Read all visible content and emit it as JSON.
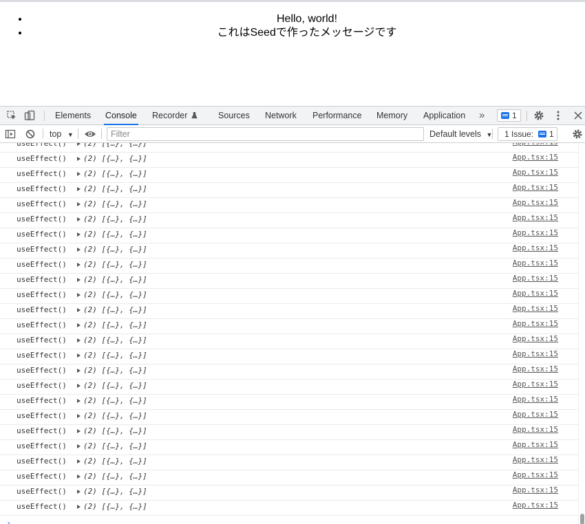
{
  "page": {
    "items": [
      "Hello, world!",
      "これはSeedで作ったメッセージです"
    ]
  },
  "devtools": {
    "tabs": [
      "Elements",
      "Console",
      "Recorder",
      "Sources",
      "Network",
      "Performance",
      "Memory",
      "Application"
    ],
    "active_tab": "Console",
    "overflow_label": "»",
    "issues_count": "1",
    "icons": [
      "inspect-icon",
      "device-toggle-icon",
      "flask-icon",
      "chevron-double-right-icon",
      "message-icon",
      "gear-icon",
      "kebab-menu-icon",
      "close-icon"
    ]
  },
  "filterbar": {
    "context": "top",
    "filter_placeholder": "Filter",
    "levels": "Default levels",
    "issue_label": "1 Issue:",
    "issue_count": "1",
    "icons": [
      "sidebar-toggle-icon",
      "clear-console-icon",
      "eye-icon",
      "message-icon",
      "gear-icon"
    ]
  },
  "console": {
    "rows": [
      {
        "fn": "useEffect()",
        "value": "(2) [{…}, {…}]",
        "source": "App.tsx:15"
      },
      {
        "fn": "useEffect()",
        "value": "(2) [{…}, {…}]",
        "source": "App.tsx:15"
      },
      {
        "fn": "useEffect()",
        "value": "(2) [{…}, {…}]",
        "source": "App.tsx:15"
      },
      {
        "fn": "useEffect()",
        "value": "(2) [{…}, {…}]",
        "source": "App.tsx:15"
      },
      {
        "fn": "useEffect()",
        "value": "(2) [{…}, {…}]",
        "source": "App.tsx:15"
      },
      {
        "fn": "useEffect()",
        "value": "(2) [{…}, {…}]",
        "source": "App.tsx:15"
      },
      {
        "fn": "useEffect()",
        "value": "(2) [{…}, {…}]",
        "source": "App.tsx:15"
      },
      {
        "fn": "useEffect()",
        "value": "(2) [{…}, {…}]",
        "source": "App.tsx:15"
      },
      {
        "fn": "useEffect()",
        "value": "(2) [{…}, {…}]",
        "source": "App.tsx:15"
      },
      {
        "fn": "useEffect()",
        "value": "(2) [{…}, {…}]",
        "source": "App.tsx:15"
      },
      {
        "fn": "useEffect()",
        "value": "(2) [{…}, {…}]",
        "source": "App.tsx:15"
      },
      {
        "fn": "useEffect()",
        "value": "(2) [{…}, {…}]",
        "source": "App.tsx:15"
      },
      {
        "fn": "useEffect()",
        "value": "(2) [{…}, {…}]",
        "source": "App.tsx:15"
      },
      {
        "fn": "useEffect()",
        "value": "(2) [{…}, {…}]",
        "source": "App.tsx:15"
      },
      {
        "fn": "useEffect()",
        "value": "(2) [{…}, {…}]",
        "source": "App.tsx:15"
      },
      {
        "fn": "useEffect()",
        "value": "(2) [{…}, {…}]",
        "source": "App.tsx:15"
      },
      {
        "fn": "useEffect()",
        "value": "(2) [{…}, {…}]",
        "source": "App.tsx:15"
      },
      {
        "fn": "useEffect()",
        "value": "(2) [{…}, {…}]",
        "source": "App.tsx:15"
      },
      {
        "fn": "useEffect()",
        "value": "(2) [{…}, {…}]",
        "source": "App.tsx:15"
      },
      {
        "fn": "useEffect()",
        "value": "(2) [{…}, {…}]",
        "source": "App.tsx:15"
      },
      {
        "fn": "useEffect()",
        "value": "(2) [{…}, {…}]",
        "source": "App.tsx:15"
      },
      {
        "fn": "useEffect()",
        "value": "(2) [{…}, {…}]",
        "source": "App.tsx:15"
      },
      {
        "fn": "useEffect()",
        "value": "(2) [{…}, {…}]",
        "source": "App.tsx:15"
      },
      {
        "fn": "useEffect()",
        "value": "(2) [{…}, {…}]",
        "source": "App.tsx:15"
      },
      {
        "fn": "useEffect()",
        "value": "(2) [{…}, {…}]",
        "source": "App.tsx:15"
      }
    ],
    "prompt_glyph": "›"
  },
  "colors": {
    "accent": "#1a73e8",
    "toolbar_bg": "#f1f3f4",
    "row_divider": "#e8eaed"
  }
}
